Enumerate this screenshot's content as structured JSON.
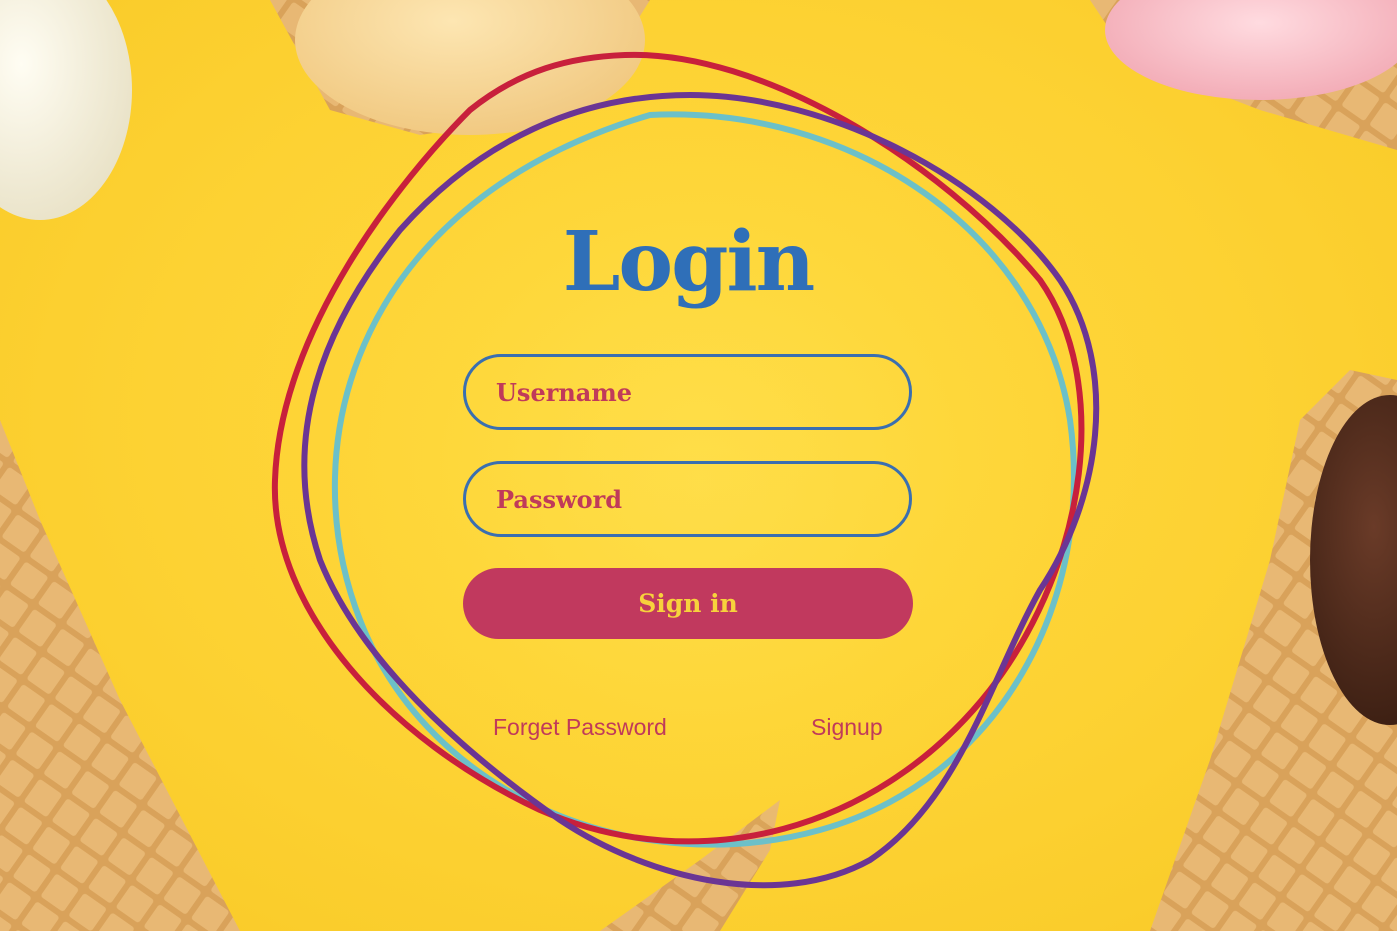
{
  "login": {
    "title": "Login",
    "username_placeholder": "Username",
    "password_placeholder": "Password",
    "signin_label": "Sign in",
    "forget_password_label": "Forget Password",
    "signup_label": "Signup"
  },
  "colors": {
    "background": "#fdd33a",
    "title": "#2f6fb8",
    "field_border": "#3a6fb0",
    "accent": "#c1395e",
    "button_text": "#f7d23c",
    "ring_red": "#c8203c",
    "ring_purple": "#6b3594",
    "ring_teal": "#6cc0c8"
  },
  "background_image": "ice-cream-cones-on-yellow"
}
